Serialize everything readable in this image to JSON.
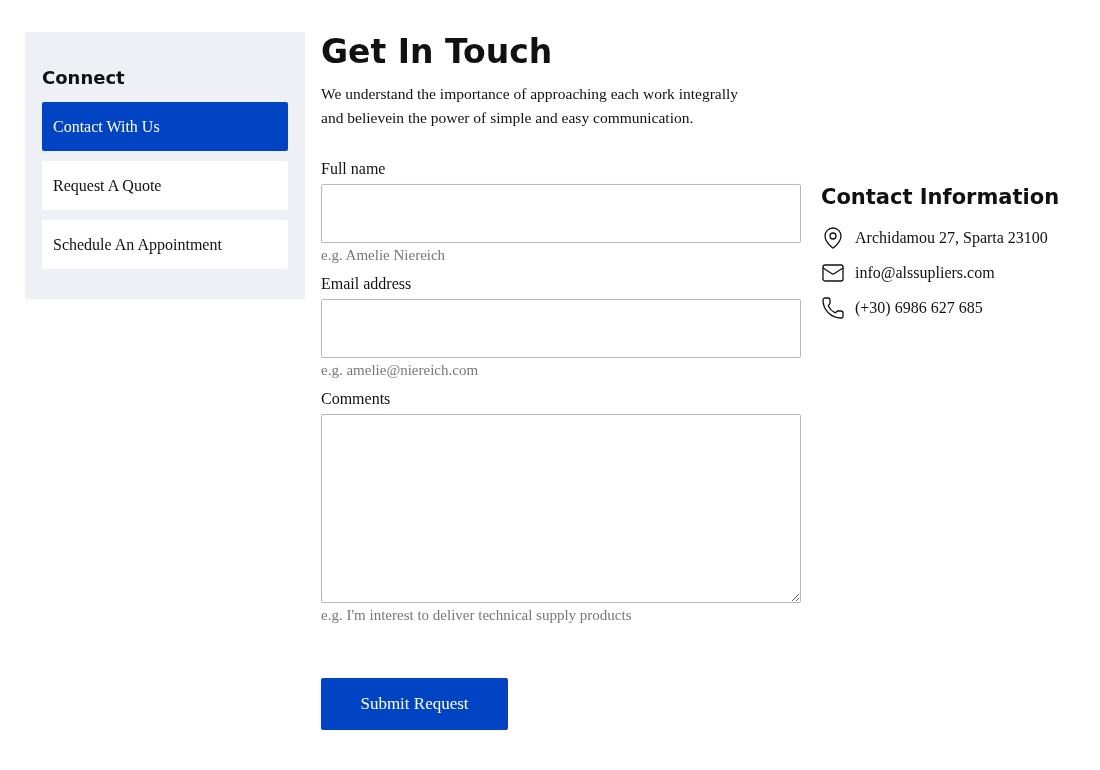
{
  "sidebar": {
    "title": "Connect",
    "items": [
      {
        "label": "Contact With Us",
        "selected": true
      },
      {
        "label": "Request A Quote",
        "selected": false
      },
      {
        "label": "Schedule An Appointment",
        "selected": false
      }
    ]
  },
  "form": {
    "title": "Get In Touch",
    "intro": "We understand the importance of approaching each work integrally and believein the power of simple and easy communication.",
    "fields": [
      {
        "kind": "input",
        "label": "Full name",
        "hint": "e.g. Amelie Niereich"
      },
      {
        "kind": "input",
        "label": "Email address",
        "hint": "e.g. amelie@niereich.com"
      },
      {
        "kind": "textarea",
        "label": "Comments",
        "hint": "e.g. I'm interest to deliver technical supply products"
      }
    ],
    "submit": "Submit Request"
  },
  "contact": {
    "title": "Contact Information",
    "items": [
      {
        "kind": "address",
        "text": "Archidamou 27, Sparta 23100"
      },
      {
        "kind": "email",
        "text": "info@alssupliers.com"
      },
      {
        "kind": "phone",
        "text": "(+30) 6986 627 685"
      }
    ]
  }
}
